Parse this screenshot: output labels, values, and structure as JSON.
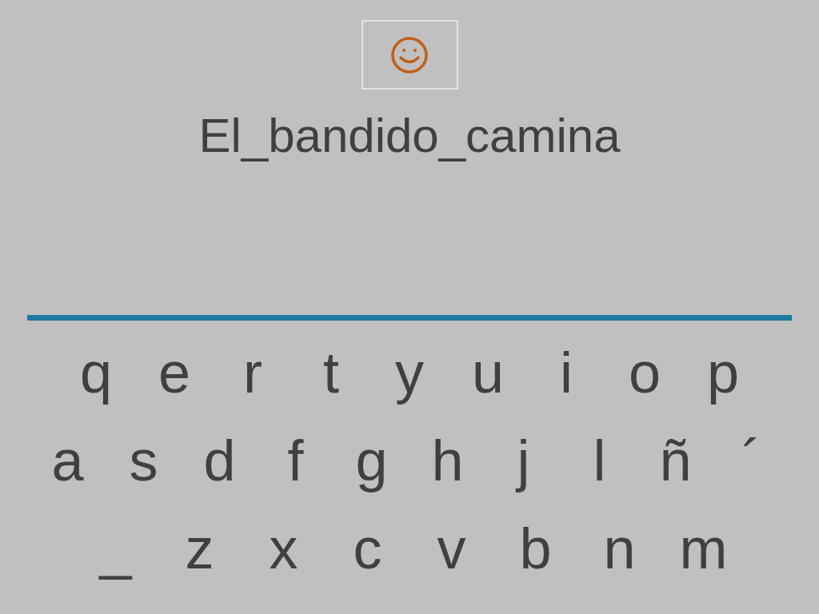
{
  "sentence": "El_bandido_camina",
  "keyboard": {
    "rows": [
      [
        "q",
        "e",
        "r",
        "t",
        "y",
        "u",
        "i",
        "o",
        "p"
      ],
      [
        "a",
        "s",
        "d",
        "f",
        "g",
        "h",
        "j",
        "l",
        "ñ",
        "´"
      ],
      [
        "_",
        "z",
        "x",
        "c",
        "v",
        "b",
        "n",
        "m"
      ]
    ]
  }
}
